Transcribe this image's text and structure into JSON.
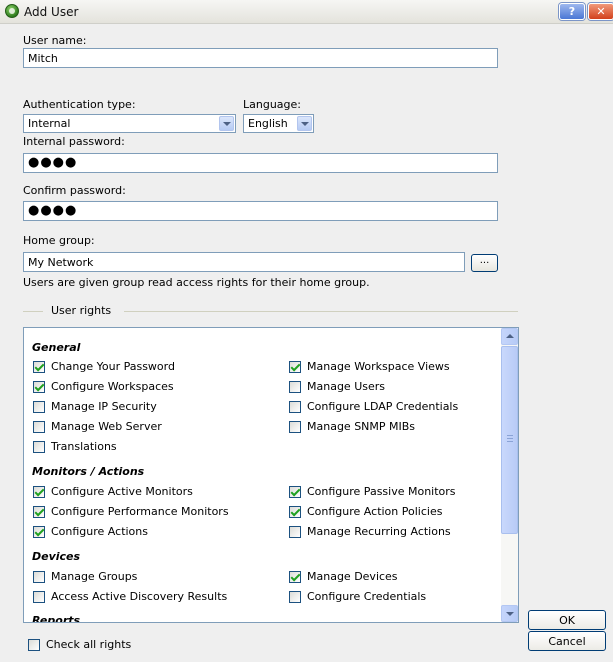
{
  "window": {
    "title": "Add User"
  },
  "form": {
    "username_label": "User name:",
    "username_value": "Mitch",
    "auth_label": "Authentication type:",
    "auth_value": "Internal",
    "language_label": "Language:",
    "language_value": "English",
    "internal_password_label": "Internal password:",
    "internal_password_value": "●●●●",
    "confirm_password_label": "Confirm password:",
    "confirm_password_value": "●●●●",
    "home_group_label": "Home group:",
    "home_group_value": "My Network",
    "browse_label": "...",
    "home_group_note": "Users are given group read access rights for their home group."
  },
  "rights": {
    "group_label": "User rights",
    "sections": {
      "general": "General",
      "monitors": "Monitors / Actions",
      "devices": "Devices",
      "reports": "Reports"
    },
    "items": {
      "change_password": {
        "label": "Change Your Password",
        "checked": true
      },
      "manage_workspace_views": {
        "label": "Manage Workspace Views",
        "checked": true
      },
      "configure_workspaces": {
        "label": "Configure Workspaces",
        "checked": true
      },
      "manage_users": {
        "label": "Manage Users",
        "checked": false
      },
      "manage_ip_security": {
        "label": "Manage IP Security",
        "checked": false
      },
      "configure_ldap": {
        "label": "Configure LDAP Credentials",
        "checked": false
      },
      "manage_web_server": {
        "label": "Manage Web Server",
        "checked": false
      },
      "manage_snmp_mibs": {
        "label": "Manage SNMP MIBs",
        "checked": false
      },
      "translations": {
        "label": "Translations",
        "checked": false
      },
      "configure_active_monitors": {
        "label": "Configure Active Monitors",
        "checked": true
      },
      "configure_passive_monitors": {
        "label": "Configure Passive Monitors",
        "checked": true
      },
      "configure_performance_monitors": {
        "label": "Configure Performance Monitors",
        "checked": true
      },
      "configure_action_policies": {
        "label": "Configure Action Policies",
        "checked": true
      },
      "configure_actions": {
        "label": "Configure Actions",
        "checked": true
      },
      "manage_recurring_actions": {
        "label": "Manage Recurring Actions",
        "checked": false
      },
      "manage_groups": {
        "label": "Manage Groups",
        "checked": false
      },
      "manage_devices": {
        "label": "Manage Devices",
        "checked": true
      },
      "access_discovery": {
        "label": "Access Active Discovery Results",
        "checked": false
      },
      "configure_credentials": {
        "label": "Configure Credentials",
        "checked": false
      }
    },
    "check_all_label": "Check all rights",
    "check_all_checked": false
  },
  "buttons": {
    "ok": "OK",
    "cancel": "Cancel",
    "help": "?",
    "close": "✕"
  },
  "colors": {
    "accent": "#7f9db9",
    "check": "#21a121",
    "button_border": "#003c74"
  }
}
